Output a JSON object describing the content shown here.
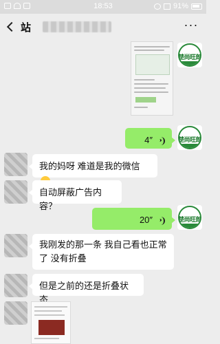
{
  "status_bar": {
    "time": "18:53",
    "battery": "91%"
  },
  "nav": {
    "title_prefix": "站",
    "more_label": "···"
  },
  "messages": {
    "m1_voice": "4″",
    "m2_text": "我的妈呀 难道是我的微信",
    "m3_text": "自动屏蔽广告内容？",
    "m4_voice": "20″",
    "m5_text": "我刚发的那一条 我自己看也正常了 没有折叠",
    "m6_text": "但是之前的还是折叠状态"
  },
  "avatar_brand": "楚尚旺郎"
}
